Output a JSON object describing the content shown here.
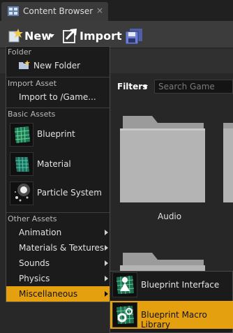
{
  "tab": {
    "title": "Content Browser",
    "close": "×"
  },
  "toolbar": {
    "new_label": "New",
    "import_label": "Import"
  },
  "filters": {
    "label": "Filters",
    "search_placeholder": "Search Game"
  },
  "content": {
    "folder_caption": "Audio"
  },
  "menu": {
    "folder_header": "Folder",
    "new_folder": "New Folder",
    "import_header": "Import Asset",
    "import_to": "Import to /Game...",
    "basic_header": "Basic Assets",
    "blueprint": "Blueprint",
    "material": "Material",
    "particle": "Particle System",
    "other_header": "Other Assets",
    "animation": "Animation",
    "materials_textures": "Materials & Textures",
    "sounds": "Sounds",
    "physics": "Physics",
    "miscellaneous": "Miscellaneous"
  },
  "submenu": {
    "blueprint_interface": "Blueprint Interface",
    "blueprint_macro_library": "Blueprint Macro Library"
  },
  "colors": {
    "highlight": "#e5a010",
    "menu_bg": "#1b1b1b",
    "toolbar_bg": "#3c3c3c"
  }
}
